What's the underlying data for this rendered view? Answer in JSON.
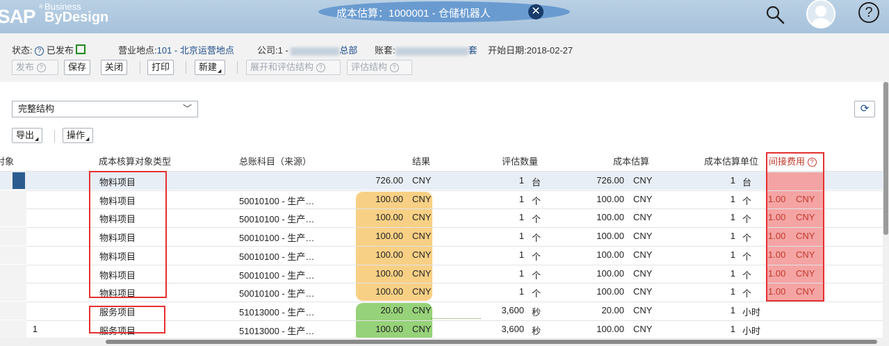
{
  "shell": {
    "logo_sap": "SAP",
    "logo_registered": "®",
    "logo_business": "Business",
    "logo_bydesign": "ByDesign",
    "title": "成本估算：1000001 - 仓储机器人",
    "close_glyph": "✕",
    "help_glyph": "?"
  },
  "header": {
    "status_label": "状态:",
    "status_value": "已发布",
    "site_label": "营业地点:",
    "site_value": "101 - 北京运营地点",
    "company_label": "公司:",
    "company_value_prefix": "1 - ",
    "company_value_suffix": "总部",
    "books_label": "账套:",
    "books_value_suffix": "套",
    "start_label": "开始日期:",
    "start_value": "2018-02-27",
    "buttons": {
      "release": "发布",
      "save": "保存",
      "close": "关闭",
      "print": "打印",
      "new": "新建",
      "expand_evaluate": "展开和评估结构",
      "evaluate": "评估结构"
    }
  },
  "content": {
    "view_select": "完整结构",
    "export_label": "导出",
    "actions_label": "操作"
  },
  "table": {
    "columns": {
      "object": "对象",
      "object_type": "成本核算对象类型",
      "gl_account": "总账科目（来源）",
      "result": "结果",
      "eval_qty": "评估数量",
      "cost_estimate": "成本估算",
      "cost_unit": "成本估算单位",
      "overhead": "间接费用"
    },
    "rows": [
      {
        "left": "",
        "type": "物料项目",
        "account": "",
        "result": "726.00",
        "result_cur": "CNY",
        "qty": "1",
        "qty_unit": "台",
        "cost": "726.00",
        "cost_cur": "CNY",
        "unit_qty": "1",
        "unit_uom": "台",
        "ovh": "",
        "ovh_cur": ""
      },
      {
        "left": "",
        "type": "物料项目",
        "account": "50010100 - 生产…",
        "result": "100.00",
        "result_cur": "CNY",
        "qty": "1",
        "qty_unit": "个",
        "cost": "100.00",
        "cost_cur": "CNY",
        "unit_qty": "1",
        "unit_uom": "个",
        "ovh": "1.00",
        "ovh_cur": "CNY"
      },
      {
        "left": "",
        "type": "物料项目",
        "account": "50010100 - 生产…",
        "result": "100.00",
        "result_cur": "CNY",
        "qty": "1",
        "qty_unit": "个",
        "cost": "100.00",
        "cost_cur": "CNY",
        "unit_qty": "1",
        "unit_uom": "个",
        "ovh": "1.00",
        "ovh_cur": "CNY"
      },
      {
        "left": "",
        "type": "物料项目",
        "account": "50010100 - 生产…",
        "result": "100.00",
        "result_cur": "CNY",
        "qty": "1",
        "qty_unit": "个",
        "cost": "100.00",
        "cost_cur": "CNY",
        "unit_qty": "1",
        "unit_uom": "个",
        "ovh": "1.00",
        "ovh_cur": "CNY"
      },
      {
        "left": "",
        "type": "物料项目",
        "account": "50010100 - 生产…",
        "result": "100.00",
        "result_cur": "CNY",
        "qty": "1",
        "qty_unit": "个",
        "cost": "100.00",
        "cost_cur": "CNY",
        "unit_qty": "1",
        "unit_uom": "个",
        "ovh": "1.00",
        "ovh_cur": "CNY"
      },
      {
        "left": "",
        "type": "物料项目",
        "account": "50010100 - 生产…",
        "result": "100.00",
        "result_cur": "CNY",
        "qty": "1",
        "qty_unit": "个",
        "cost": "100.00",
        "cost_cur": "CNY",
        "unit_qty": "1",
        "unit_uom": "个",
        "ovh": "1.00",
        "ovh_cur": "CNY"
      },
      {
        "left": "",
        "type": "物料项目",
        "account": "50010100 - 生产…",
        "result": "100.00",
        "result_cur": "CNY",
        "qty": "1",
        "qty_unit": "个",
        "cost": "100.00",
        "cost_cur": "CNY",
        "unit_qty": "1",
        "unit_uom": "个",
        "ovh": "1.00",
        "ovh_cur": "CNY"
      },
      {
        "left": "",
        "type": "服务项目",
        "account": "51013000 - 生产…",
        "result": "20.00",
        "result_cur": "CNY",
        "qty": "3,600",
        "qty_unit": "秒",
        "cost": "20.00",
        "cost_cur": "CNY",
        "unit_qty": "1",
        "unit_uom": "小时",
        "ovh": "",
        "ovh_cur": ""
      },
      {
        "left": "1",
        "type": "服务项目",
        "account": "51013000 - 生产…",
        "result": "100.00",
        "result_cur": "CNY",
        "qty": "3,600",
        "qty_unit": "秒",
        "cost": "100.00",
        "cost_cur": "CNY",
        "unit_qty": "1",
        "unit_uom": "小时",
        "ovh": "",
        "ovh_cur": ""
      }
    ]
  }
}
